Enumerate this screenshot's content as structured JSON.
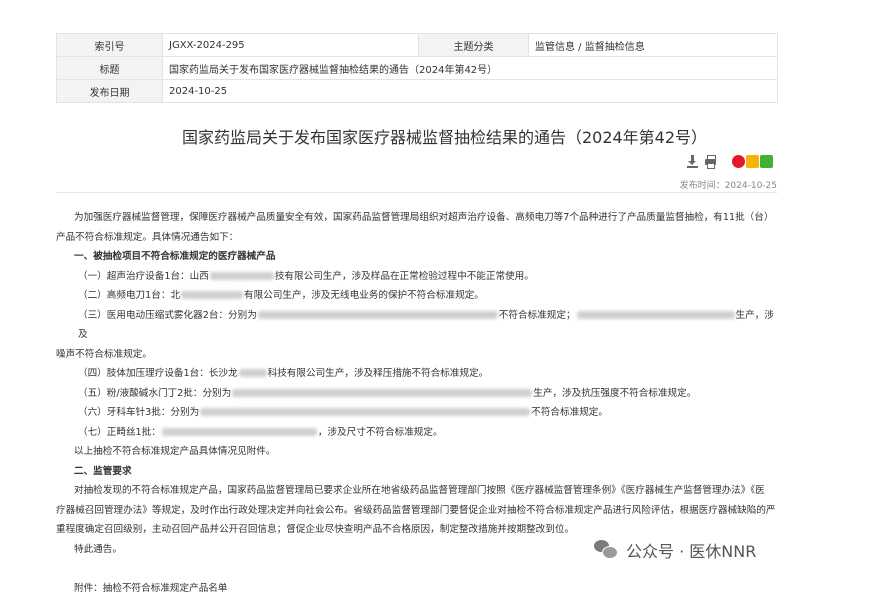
{
  "meta": {
    "index_label": "索引号",
    "index_value": "JGXX-2024-295",
    "category_label": "主题分类",
    "category_value": "监管信息 / 监督抽检信息",
    "title_label": "标题",
    "title_value": "国家药监局关于发布国家医疗器械监督抽检结果的通告（2024年第42号）",
    "date_label": "发布日期",
    "date_value": "2024-10-25"
  },
  "document": {
    "title": "国家药监局关于发布国家医疗器械监督抽检结果的通告（2024年第42号）",
    "publish_time": "发布时间：2024-10-25"
  },
  "icons": {
    "download": "download-icon",
    "print": "print-icon",
    "weibo": "weibo-icon",
    "qzone": "qzone-icon",
    "wechat": "wechat-icon"
  },
  "content": {
    "intro": "为加强医疗器械监督管理，保障医疗器械产品质量安全有效，国家药品监督管理局组织对超声治疗设备、高频电刀等7个品种进行了产品质量监督抽检，有11批（台）",
    "intro2": "产品不符合标准规定。具体情况通告如下：",
    "sec1": "一、被抽检项目不符合标准规定的医疗器械产品",
    "i1a": "（一）超声治疗设备1台：山西",
    "i1b": "技有限公司生产，涉及样品在正常检验过程中不能正常使用。",
    "i2a": "（二）高频电刀1台：北",
    "i2b": "有限公司生产，涉及无线电业务的保护不符合标准规定。",
    "i3a": "（三）医用电动压缩式雾化器2台：分别为",
    "i3b": "不符合标准规定；",
    "i3c": "生产，涉及",
    "i3d": "噪声不符合标准规定。",
    "i4a": "（四）肢体加压理疗设备1台：长沙龙",
    "i4b": "科技有限公司生产，涉及释压措施不符合标准规定。",
    "i5a": "（五）粉/液酸碱水门丁2批：分别为",
    "i5b": "生产，涉及抗压强度不符合标准规定。",
    "i6a": "（六）牙科车针3批：分别为",
    "i6b": "不符合标准规定。",
    "i7a": "（七）正畸丝1批：",
    "i7b": "，涉及尺寸不符合标准规定。",
    "see_attachment": "以上抽检不符合标准规定产品具体情况见附件。",
    "sec2": "二、监管要求",
    "req1": "对抽检发现的不符合标准规定产品，国家药品监督管理局已要求企业所在地省级药品监督管理部门按照《医疗器械监督管理条例》《医疗器械生产监督管理办法》《医",
    "req2": "疗器械召回管理办法》等规定，及时作出行政处理决定并向社会公布。省级药品监督管理部门要督促企业对抽检不符合标准规定产品进行风险评估，根据医疗器械缺陷的严",
    "req3": "重程度确定召回级别，主动召回产品并公开召回信息；督促企业尽快查明产品不合格原因，制定整改措施并按期整改到位。",
    "notice": "特此通告。",
    "attachment": "附件：抽检不符合标准规定产品名单"
  },
  "watermark": {
    "text": "公众号 · 医休NNR"
  }
}
